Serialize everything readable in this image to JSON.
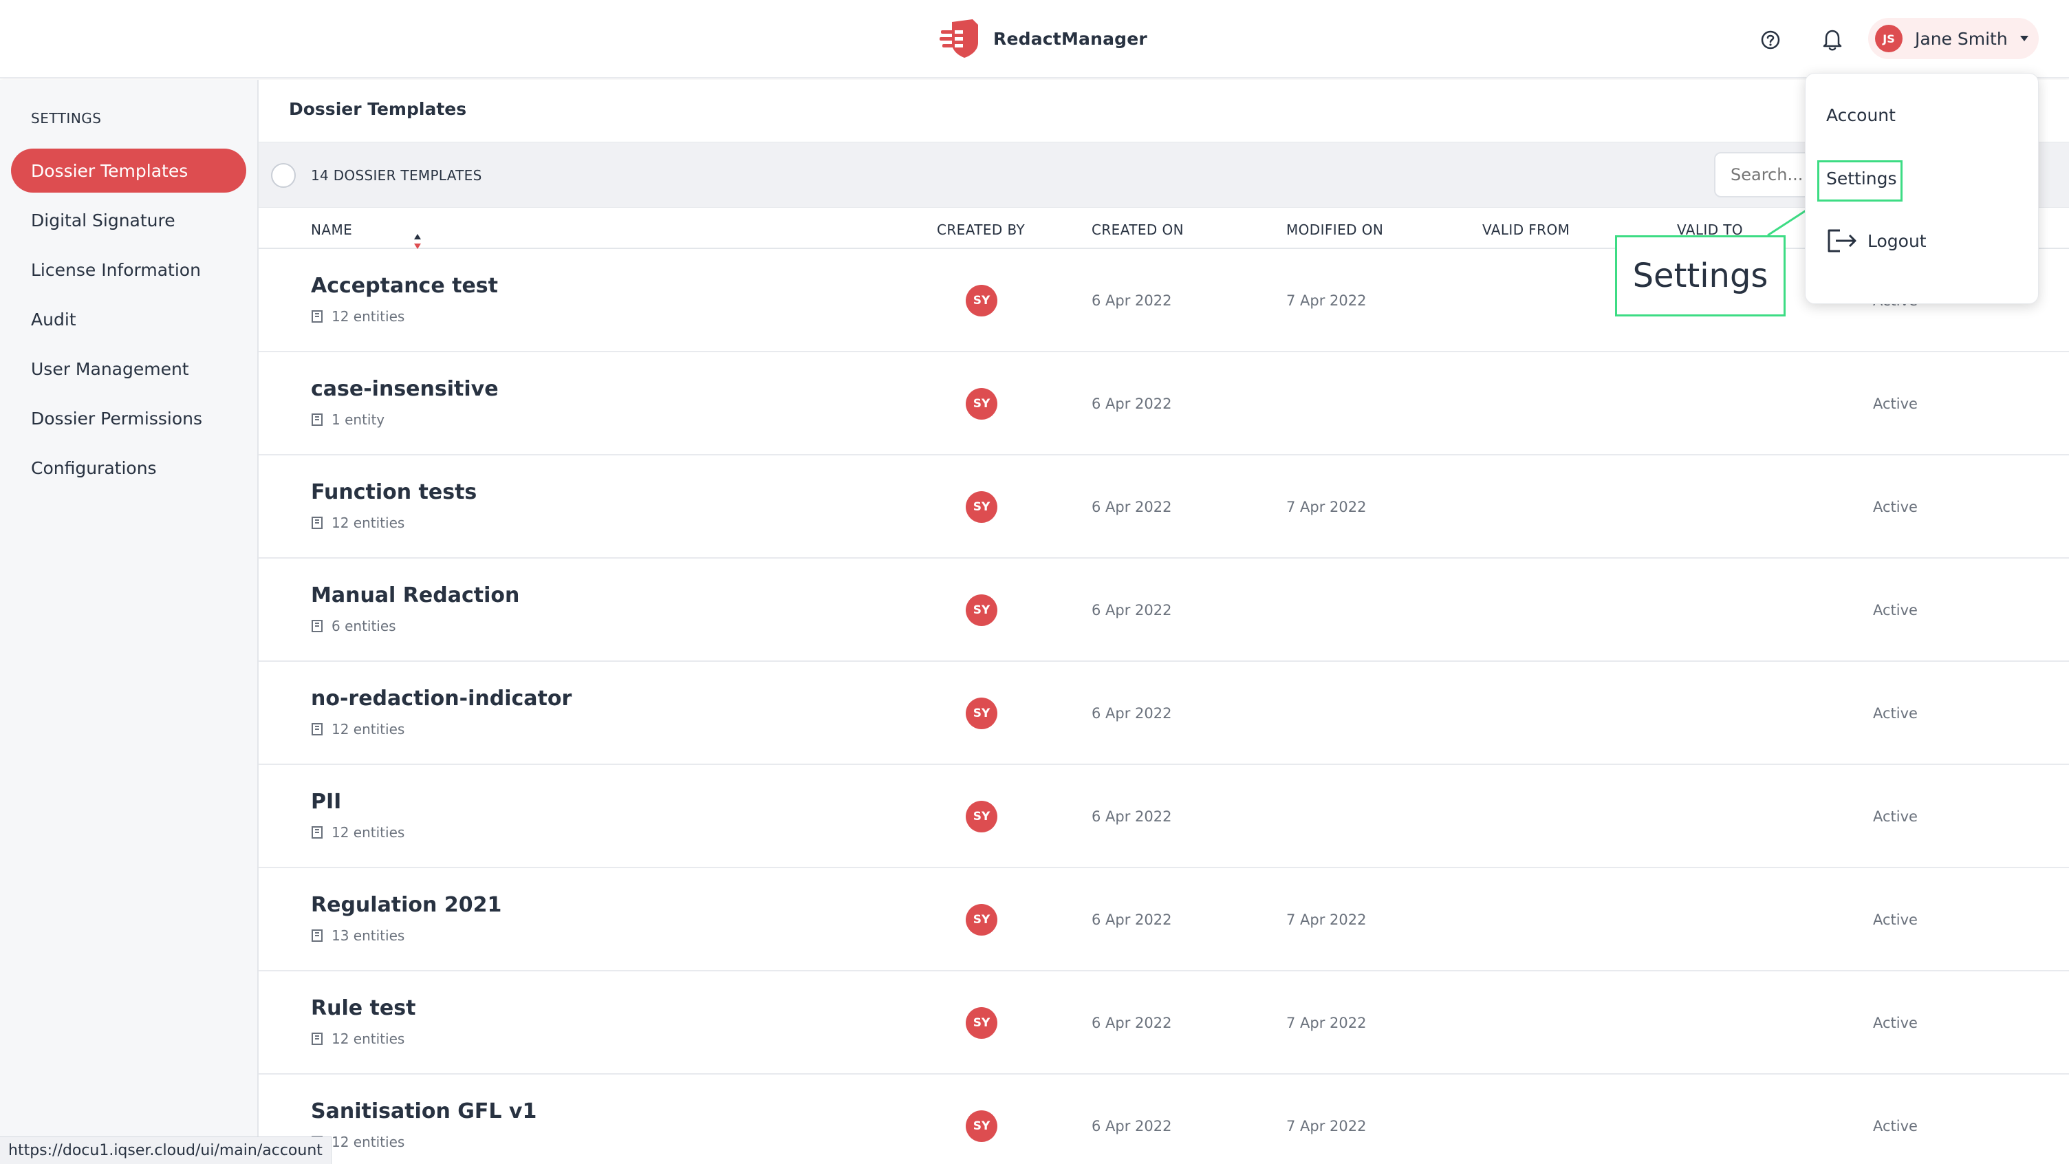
{
  "app": {
    "name": "RedactManager"
  },
  "user": {
    "initials": "JS",
    "name": "Jane Smith"
  },
  "sidebar": {
    "title": "SETTINGS",
    "items": [
      {
        "label": "Dossier Templates",
        "active": true
      },
      {
        "label": "Digital Signature",
        "active": false
      },
      {
        "label": "License Information",
        "active": false
      },
      {
        "label": "Audit",
        "active": false
      },
      {
        "label": "User Management",
        "active": false
      },
      {
        "label": "Dossier Permissions",
        "active": false
      },
      {
        "label": "Configurations",
        "active": false
      }
    ]
  },
  "main": {
    "title": "Dossier Templates",
    "count_label": "14 DOSSIER TEMPLATES",
    "search_placeholder": "Search...",
    "columns": {
      "name": "NAME",
      "created_by": "CREATED BY",
      "created_on": "CREATED ON",
      "modified_on": "MODIFIED ON",
      "valid_from": "VALID FROM",
      "valid_to": "VALID TO"
    },
    "rows": [
      {
        "name": "Acceptance test",
        "entities": "12 entities",
        "created_by": "SY",
        "created_on": "6 Apr 2022",
        "modified_on": "7 Apr 2022",
        "status": "Active"
      },
      {
        "name": "case-insensitive",
        "entities": "1 entity",
        "created_by": "SY",
        "created_on": "6 Apr 2022",
        "modified_on": "",
        "status": "Active"
      },
      {
        "name": "Function tests",
        "entities": "12 entities",
        "created_by": "SY",
        "created_on": "6 Apr 2022",
        "modified_on": "7 Apr 2022",
        "status": "Active"
      },
      {
        "name": "Manual Redaction",
        "entities": "6 entities",
        "created_by": "SY",
        "created_on": "6 Apr 2022",
        "modified_on": "",
        "status": "Active"
      },
      {
        "name": "no-redaction-indicator",
        "entities": "12 entities",
        "created_by": "SY",
        "created_on": "6 Apr 2022",
        "modified_on": "",
        "status": "Active"
      },
      {
        "name": "PII",
        "entities": "12 entities",
        "created_by": "SY",
        "created_on": "6 Apr 2022",
        "modified_on": "",
        "status": "Active"
      },
      {
        "name": "Regulation 2021",
        "entities": "13 entities",
        "created_by": "SY",
        "created_on": "6 Apr 2022",
        "modified_on": "7 Apr 2022",
        "status": "Active"
      },
      {
        "name": "Rule test",
        "entities": "12 entities",
        "created_by": "SY",
        "created_on": "6 Apr 2022",
        "modified_on": "7 Apr 2022",
        "status": "Active"
      },
      {
        "name": "Sanitisation GFL v1",
        "entities": "12 entities",
        "created_by": "SY",
        "created_on": "6 Apr 2022",
        "modified_on": "7 Apr 2022",
        "status": "Active"
      }
    ]
  },
  "user_menu": {
    "account": "Account",
    "settings": "Settings",
    "logout": "Logout"
  },
  "annotation": {
    "label": "Settings"
  },
  "status_bar": {
    "url": "https://docu1.iqser.cloud/ui/main/account"
  },
  "colors": {
    "accent": "#dd4d50",
    "highlight": "#3ddc84",
    "text": "#283241",
    "muted": "#6a717c"
  },
  "icons": [
    "shield-logo-icon",
    "help-icon",
    "bell-icon",
    "caret-down-icon",
    "sort-icon",
    "dictionary-icon",
    "logout-icon"
  ]
}
